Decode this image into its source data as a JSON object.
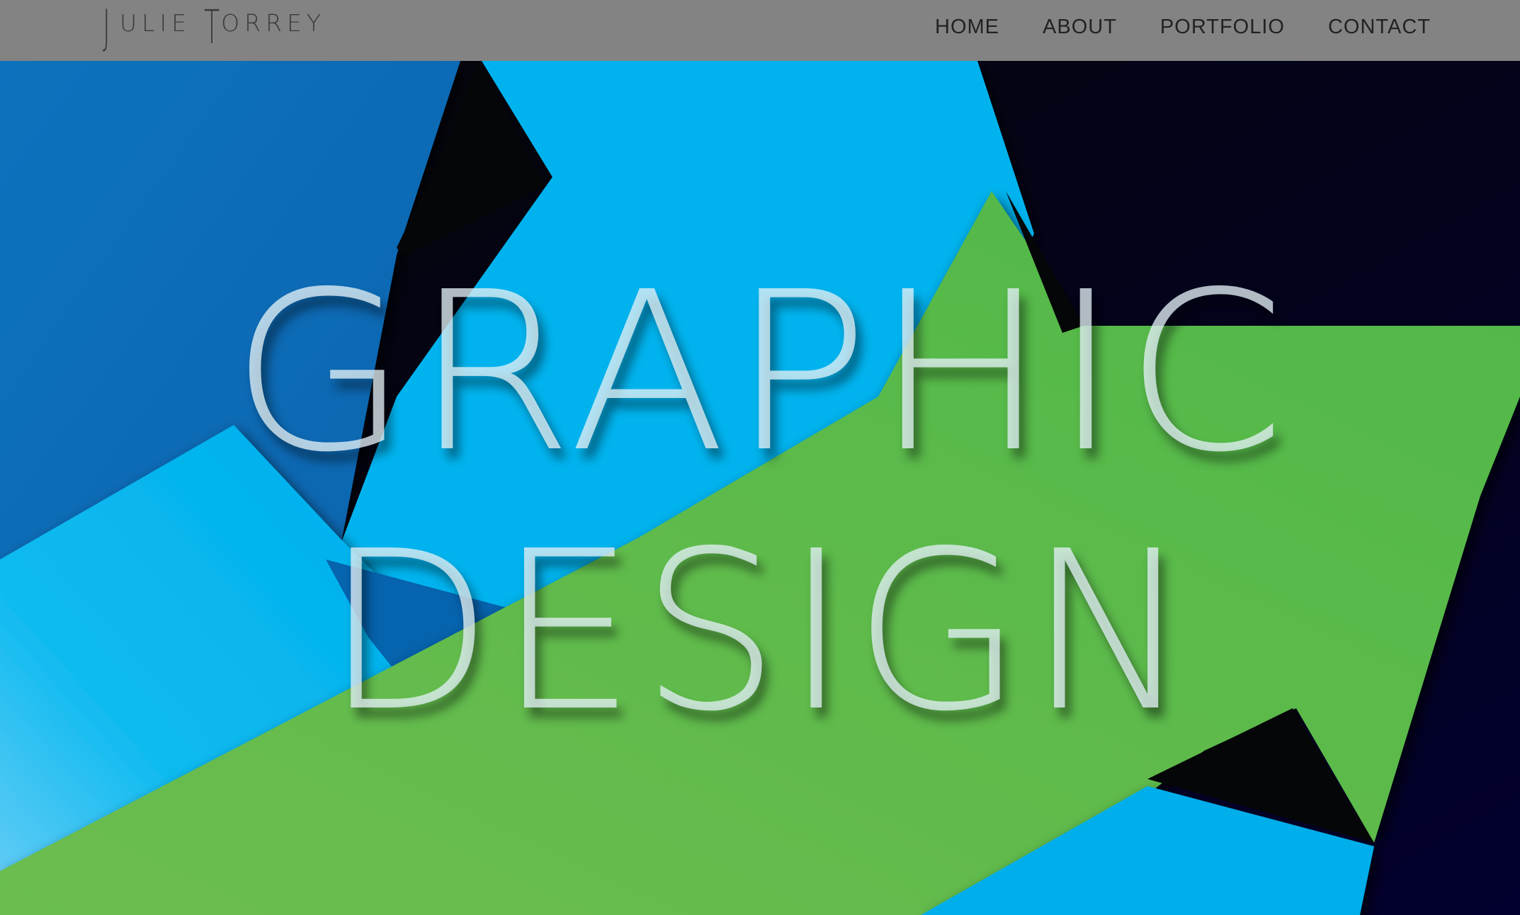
{
  "logo": {
    "initial_first": "J",
    "rest_first": "ULIE",
    "initial_last": "T",
    "rest_last": "ORREY"
  },
  "nav": {
    "items": [
      "HOME",
      "ABOUT",
      "PORTFOLIO",
      "CONTACT"
    ]
  },
  "hero": {
    "headline_line1": "GRAPHIC",
    "headline_line2": "DESIGN",
    "colors": {
      "dark_blue": "#0a6cb6",
      "light_blue": "#00b3ee",
      "green": "#56b847",
      "black": "#050607",
      "navy": "#02032a"
    }
  }
}
